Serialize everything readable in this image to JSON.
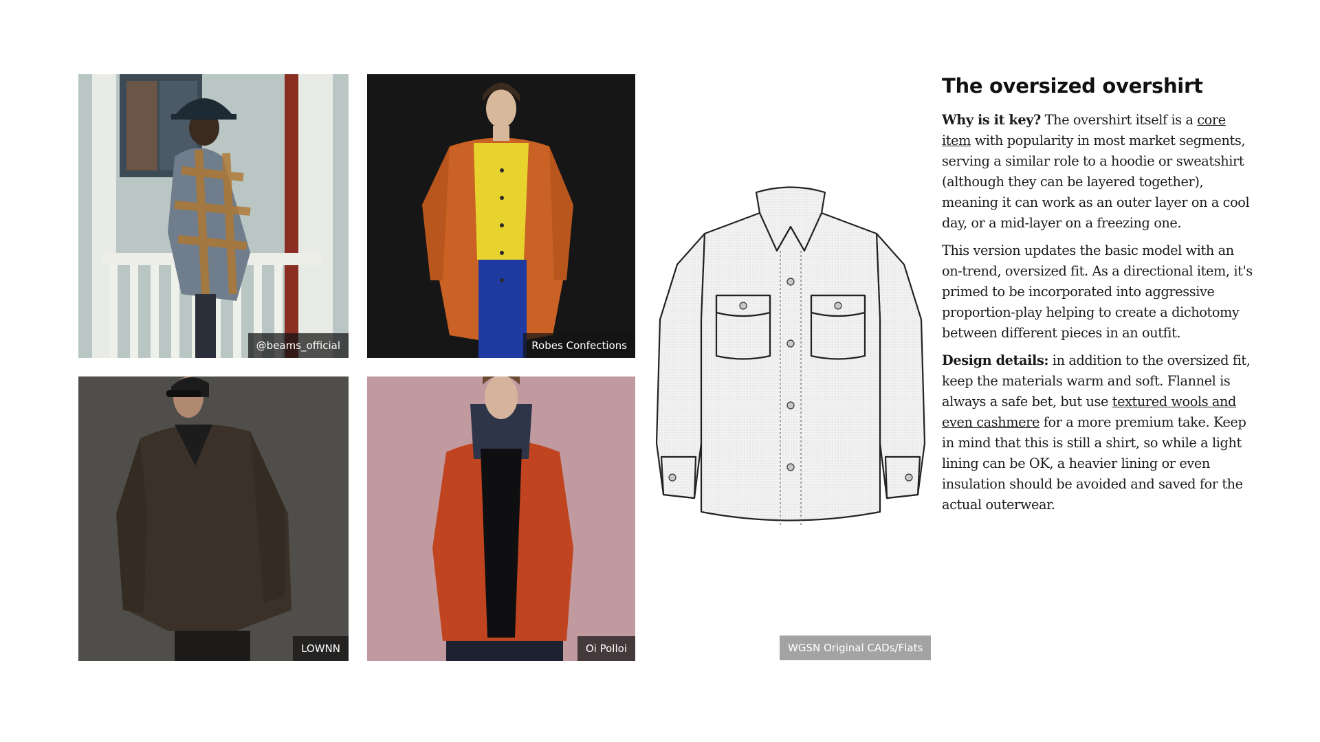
{
  "photos": [
    {
      "caption": "@beams_official"
    },
    {
      "caption": "Robes Confections"
    },
    {
      "caption": "LOWNN"
    },
    {
      "caption": "Oi Polloi"
    }
  ],
  "flat": {
    "caption": "WGSN Original CADs/Flats"
  },
  "article": {
    "title": "The oversized overshirt",
    "p1": {
      "lead": "Why is it key?",
      "t1": " The overshirt itself is a ",
      "link": "core item",
      "t2": " with popularity in most market segments, serving a similar role to a hoodie or sweatshirt (although they can be layered together), meaning it can work as an outer layer on a cool day, or a mid-layer on a freezing one."
    },
    "p2": "This version updates the basic model with an on-trend, oversized fit. As a directional item, it's primed to be incorporated into aggressive proportion-play helping to create a dichotomy between different pieces in an outfit.",
    "p3": {
      "lead": "Design details:",
      "t1": " in addition to the oversized fit, keep the materials warm and soft. Flannel is always a safe bet, but use ",
      "link": "textured wools and even cashmere",
      "t2": " for a more premium take. Keep in mind that this is still a shirt, so while a light lining can be OK, a heavier lining or even insulation should be avoided and saved for the actual outerwear."
    }
  }
}
